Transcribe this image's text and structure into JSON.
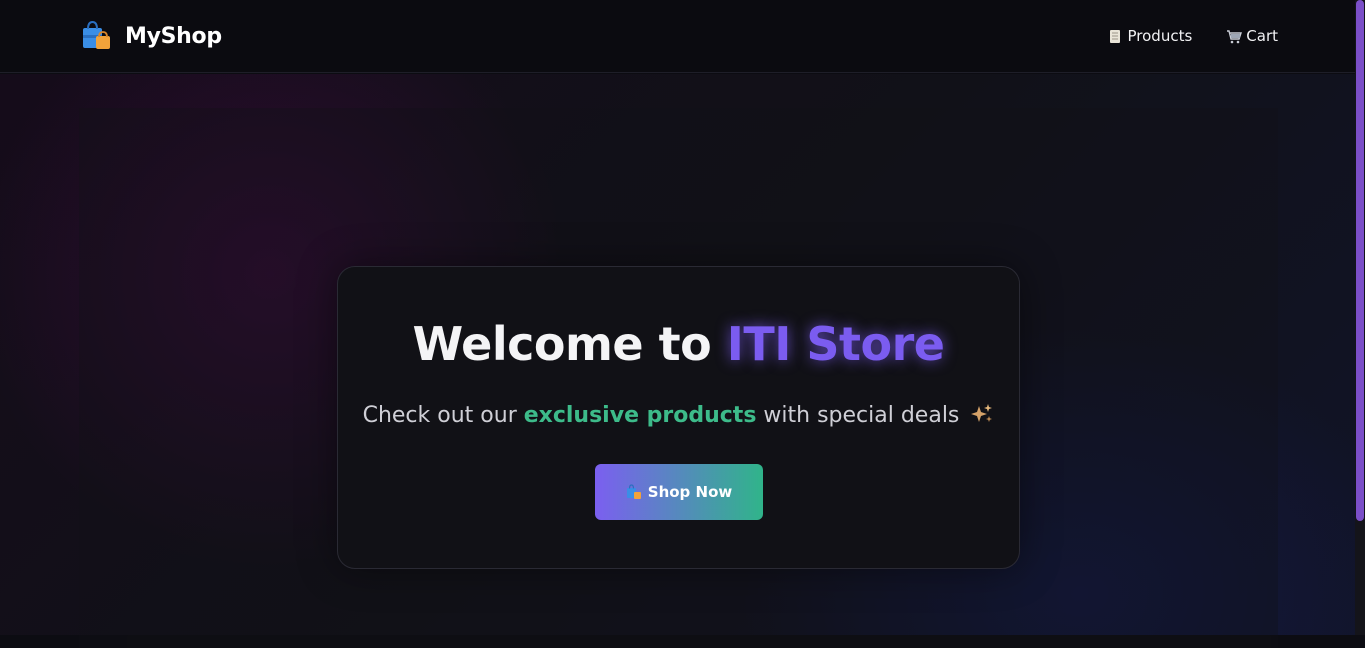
{
  "navbar": {
    "brand_name": "MyShop",
    "brand_icon": "shopping-bags-icon",
    "links": [
      {
        "label": "Products",
        "icon": "scroll-icon"
      },
      {
        "label": "Cart",
        "icon": "shopping-cart-icon"
      }
    ]
  },
  "hero": {
    "title_prefix": "Welcome to ",
    "title_accent": "ITI Store",
    "subtitle_prefix": "Check out our ",
    "subtitle_highlight": "exclusive products",
    "subtitle_suffix": " with special deals",
    "sparkle_icon": "sparkles-icon",
    "cta_label": "Shop Now",
    "cta_icon": "shopping-bags-icon"
  },
  "colors": {
    "accent_purple": "#7b5cf0",
    "accent_green": "#3dbb8a",
    "background": "#0c0c12",
    "scrollbar_thumb": "#7b4fc8"
  }
}
